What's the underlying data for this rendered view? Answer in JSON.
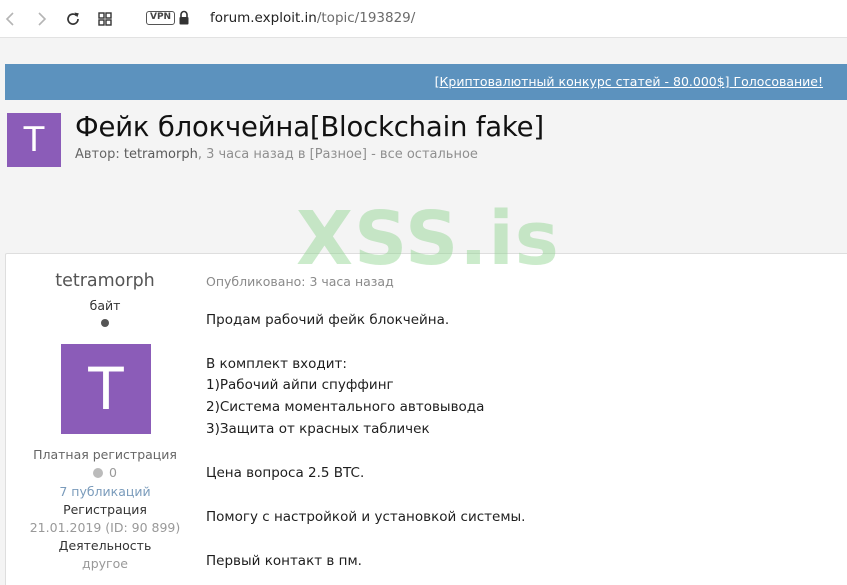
{
  "browser": {
    "vpn_label": "VPN",
    "url_domain": "forum.exploit.in",
    "url_path": "/topic/193829/"
  },
  "banner": {
    "link_text": "[Криптовалютный конкурс статей - 80.000$] Голосование!",
    "color": "#5c92be"
  },
  "topic": {
    "avatar_letter": "T",
    "title": "Фейк блокчейна[Blockchain fake]",
    "author_label": "Автор:",
    "author_name": "tetramorph",
    "time_prefix": ", 3 часа назад в [Разное] - все остальное"
  },
  "watermark": "XSS.is",
  "post": {
    "author": {
      "name": "tetramorph",
      "rank": "байт",
      "avatar_letter": "T",
      "avatar_color": "#8b5cb8",
      "group": "Платная регистрация",
      "reputation": "0",
      "posts": "7 публикаций",
      "reg_label": "Регистрация",
      "reg_value": "21.01.2019 (ID: 90 899)",
      "activity_label": "Деятельность",
      "activity_value": "другое"
    },
    "published": "Опубликовано: 3 часа назад",
    "lines": [
      "Продам рабочий фейк блокчейна.",
      "В комплект входит:",
      "1)Рабочий айпи спуффинг",
      "2)Система моментального автовывода",
      "3)Защита от красных табличек",
      "Цена вопроса 2.5 BTC.",
      "Помогу с настройкой и установкой системы.",
      "Первый контакт в пм."
    ]
  }
}
